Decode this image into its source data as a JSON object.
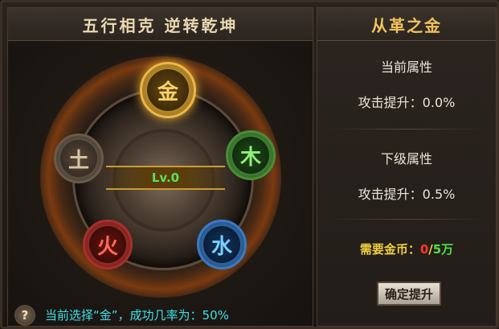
{
  "left_panel": {
    "title": "五行相克 逆转乾坤",
    "level_label": "Lv.0",
    "elements": {
      "gold": "金",
      "earth": "土",
      "wood": "木",
      "fire": "火",
      "water": "水"
    },
    "help_label": "?",
    "status_text": "当前选择“金”，成功几率为：50%"
  },
  "right_panel": {
    "title": "从革之金",
    "current_header": "当前属性",
    "current_value": "攻击提升：0.0%",
    "next_header": "下级属性",
    "next_value": "攻击提升：0.5%",
    "cost_label": "需要金币：",
    "cost_have": "0",
    "cost_sep": "/",
    "cost_need": "5万",
    "confirm_label": "确定提升"
  },
  "colors": {
    "accent_gold": "#f1c35c",
    "cost_label": "#f0d040",
    "cost_have": "#ff3a2a",
    "cost_need": "#4fe04a",
    "status_text": "#3fe0e6",
    "level_text": "#5ee05a"
  }
}
